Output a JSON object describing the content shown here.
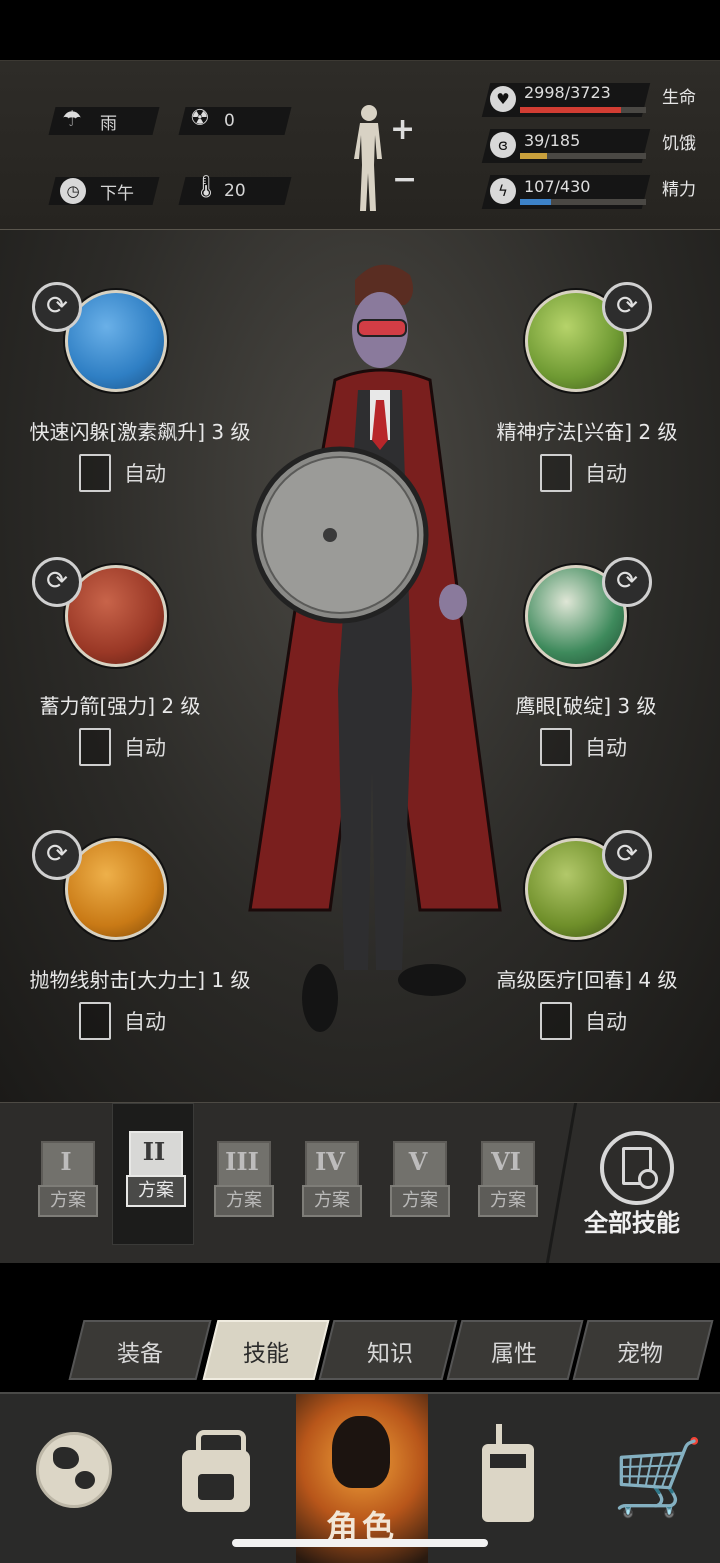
{
  "environment": {
    "weather": "雨",
    "radiation": "0",
    "time_of_day": "下午",
    "temperature": "20"
  },
  "vitals": [
    {
      "label": "生命",
      "value": "2998/3723",
      "current": 2998,
      "max": 3723,
      "color": "#d23d33",
      "icon": "heart-icon"
    },
    {
      "label": "饥饿",
      "value": "39/185",
      "current": 39,
      "max": 185,
      "color": "#c9a03c",
      "icon": "stomach-icon"
    },
    {
      "label": "精力",
      "value": "107/430",
      "current": 107,
      "max": 430,
      "color": "#3d82c8",
      "icon": "energy-icon"
    }
  ],
  "skills": {
    "s1": {
      "name": "快速闪躲[激素飙升] 3 级",
      "auto": "自动",
      "checked": false,
      "color": "#2f7fc4"
    },
    "s2": {
      "name": "精神疗法[兴奋] 2 级",
      "auto": "自动",
      "checked": false,
      "color": "#6f9a33"
    },
    "s3": {
      "name": "蓄力箭[强力] 2 级",
      "auto": "自动",
      "checked": false,
      "color": "#9a3826"
    },
    "s4": {
      "name": "鹰眼[破绽] 3 级",
      "auto": "自动",
      "checked": false,
      "color": "#3e8a5c"
    },
    "s5": {
      "name": "抛物线射击[大力士] 1 级",
      "auto": "自动",
      "checked": false,
      "color": "#c97a16"
    },
    "s6": {
      "name": "高级医疗[回春] 4 级",
      "auto": "自动",
      "checked": false,
      "color": "#6f8f2a"
    }
  },
  "plans": {
    "p1": {
      "numeral": "I",
      "label": "方案"
    },
    "p2": {
      "numeral": "II",
      "label": "方案",
      "selected": true
    },
    "p3": {
      "numeral": "III",
      "label": "方案"
    },
    "p4": {
      "numeral": "IV",
      "label": "方案"
    },
    "p5": {
      "numeral": "V",
      "label": "方案"
    },
    "p6": {
      "numeral": "VI",
      "label": "方案"
    }
  },
  "all_skills_label": "全部技能",
  "tabs": {
    "equip": "装备",
    "skills": "技能",
    "knowledge": "知识",
    "attributes": "属性",
    "pets": "宠物",
    "active": "技能"
  },
  "nav": {
    "character": "角色"
  }
}
